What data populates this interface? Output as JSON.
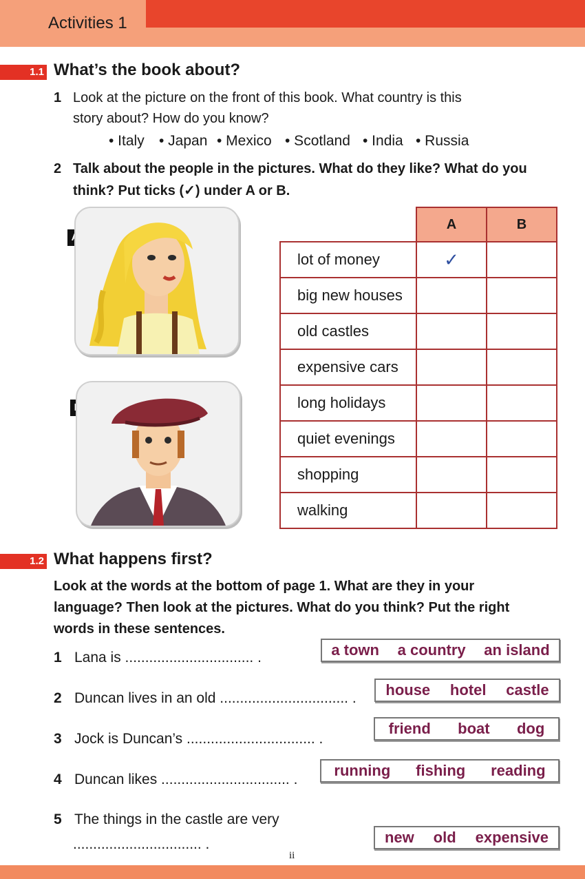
{
  "header": {
    "title": "Activities 1"
  },
  "section1": {
    "badge": "1.1",
    "title": "What’s the book about?",
    "q1": {
      "num": "1",
      "line1": "Look at the picture on the front of this book. What country is this",
      "line2": "story about? How do you know?",
      "options": [
        "• Italy",
        "• Japan",
        "• Mexico",
        "• Scotland",
        "• India",
        "• Russia"
      ]
    },
    "q2": {
      "num": "2",
      "line1": "Talk about the people in the pictures. What do they like? What do you",
      "line2": "think? Put ticks (✓) under A or B."
    },
    "pictures": {
      "a_label": "A",
      "b_label": "B"
    },
    "table": {
      "col_a": "A",
      "col_b": "B",
      "rows": [
        {
          "label": "lot of money",
          "a": "✓",
          "b": ""
        },
        {
          "label": "big new houses",
          "a": "",
          "b": ""
        },
        {
          "label": "old castles",
          "a": "",
          "b": ""
        },
        {
          "label": "expensive cars",
          "a": "",
          "b": ""
        },
        {
          "label": "long holidays",
          "a": "",
          "b": ""
        },
        {
          "label": "quiet evenings",
          "a": "",
          "b": ""
        },
        {
          "label": "shopping",
          "a": "",
          "b": ""
        },
        {
          "label": "walking",
          "a": "",
          "b": ""
        }
      ]
    }
  },
  "section2": {
    "badge": "1.2",
    "title": "What happens first?",
    "intro": [
      "Look at the words at the bottom of page 1. What are they in your",
      "language? Then look at the pictures. What do you think? Put the right",
      "words in these sentences."
    ],
    "sentences": [
      {
        "num": "1",
        "text": "Lana is ................................ .",
        "words": [
          "a town",
          "a country",
          "an island"
        ]
      },
      {
        "num": "2",
        "text": "Duncan lives in an old ................................ .",
        "words": [
          "house",
          "hotel",
          "castle"
        ]
      },
      {
        "num": "3",
        "text": "Jock is Duncan’s ................................ .",
        "words": [
          "friend",
          "boat",
          "dog"
        ]
      },
      {
        "num": "4",
        "text": "Duncan likes ................................ .",
        "words": [
          "running",
          "fishing",
          "reading"
        ]
      },
      {
        "num": "5",
        "text": "The things in the castle are very",
        "text2": "................................ .",
        "words": [
          "new",
          "old",
          "expensive"
        ]
      }
    ]
  },
  "footer": {
    "page": "ii"
  },
  "colors": {
    "badge": "#e33124",
    "header_band": "#f5a07a",
    "table_border": "#a93030",
    "table_header": "#f4a88d",
    "word_color": "#7a1e4a"
  }
}
